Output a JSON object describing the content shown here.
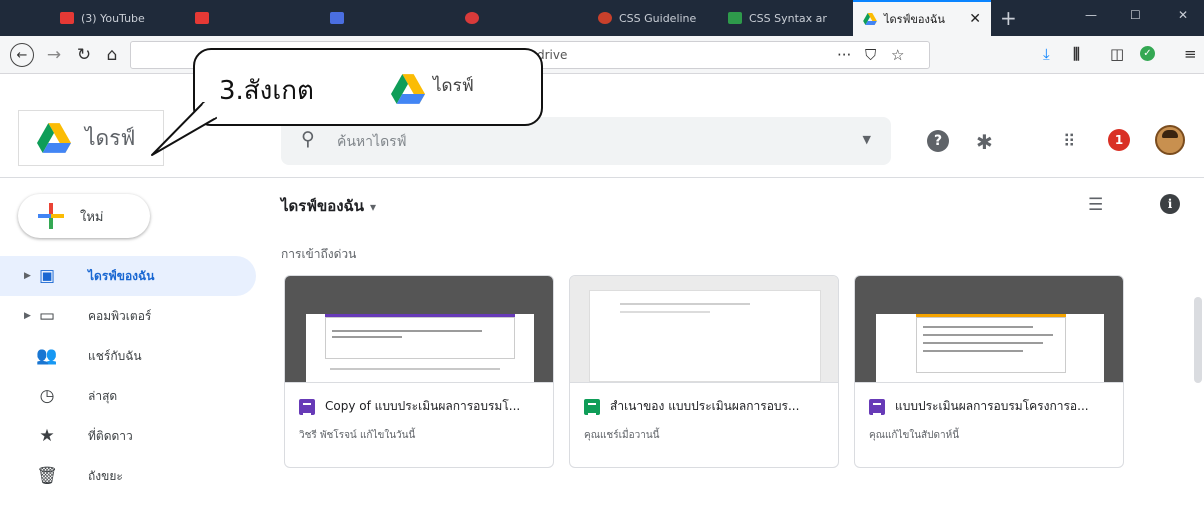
{
  "browser": {
    "tabs": [
      {
        "label": "(3) YouTube",
        "color": "#e53935"
      },
      {
        "label": "",
        "color": "#e53935"
      },
      {
        "label": "",
        "color": "#4a6ee0"
      },
      {
        "label": "",
        "color": "#d83a3a"
      },
      {
        "label": "CSS Guideline",
        "color": "#c8402b"
      },
      {
        "label": "CSS Syntax ar",
        "color": "#2e9a4b"
      },
      {
        "label": "ไดรฟ์ของฉัน",
        "color": "#fbbc04"
      }
    ],
    "close_glyph": "✕",
    "new_tab_glyph": "+",
    "url": "drive",
    "toolbar_icons": [
      "download-icon",
      "library-icon",
      "sidebar-icon",
      "extension-check-icon",
      "menu-icon"
    ]
  },
  "callout": {
    "text": "3.สังเกต",
    "name": "ไดรฟ์"
  },
  "header": {
    "app_name": "ไดรฟ์",
    "search_placeholder": "ค้นหาไดรฟ์",
    "help_glyph": "?",
    "notification_count": "1"
  },
  "new_button": {
    "label": "ใหม่"
  },
  "sidebar": {
    "items": [
      {
        "label": "ไดรฟ์ของฉัน",
        "icon": "drive-icon"
      },
      {
        "label": "คอมพิวเตอร์",
        "icon": "computer-icon"
      },
      {
        "label": "แชร์กับฉัน",
        "icon": "people-icon"
      },
      {
        "label": "ล่าสุด",
        "icon": "clock-icon"
      },
      {
        "label": "ที่ติดดาว",
        "icon": "star-icon"
      },
      {
        "label": "ถังขยะ",
        "icon": "trash-icon"
      }
    ]
  },
  "main": {
    "breadcrumb": "ไดรฟ์ของฉัน",
    "quick_access": "การเข้าถึงด่วน",
    "files": [
      {
        "title": "Copy of แบบประเมินผลการอบรมโ...",
        "subtitle": "วิชรี พัชโรจน์ แก้ไขในวันนี้",
        "type": "forms",
        "color": "#673ab7"
      },
      {
        "title": "สำเนาของ แบบประเมินผลการอบร...",
        "subtitle": "คุณแชร์เมื่อวานนี้",
        "type": "sheets",
        "color": "#0f9d58"
      },
      {
        "title": "แบบประเมินผลการอบรมโครงการอ...",
        "subtitle": "คุณแก้ไขในสัปดาห์นี้",
        "type": "forms",
        "color": "#673ab7"
      }
    ]
  }
}
